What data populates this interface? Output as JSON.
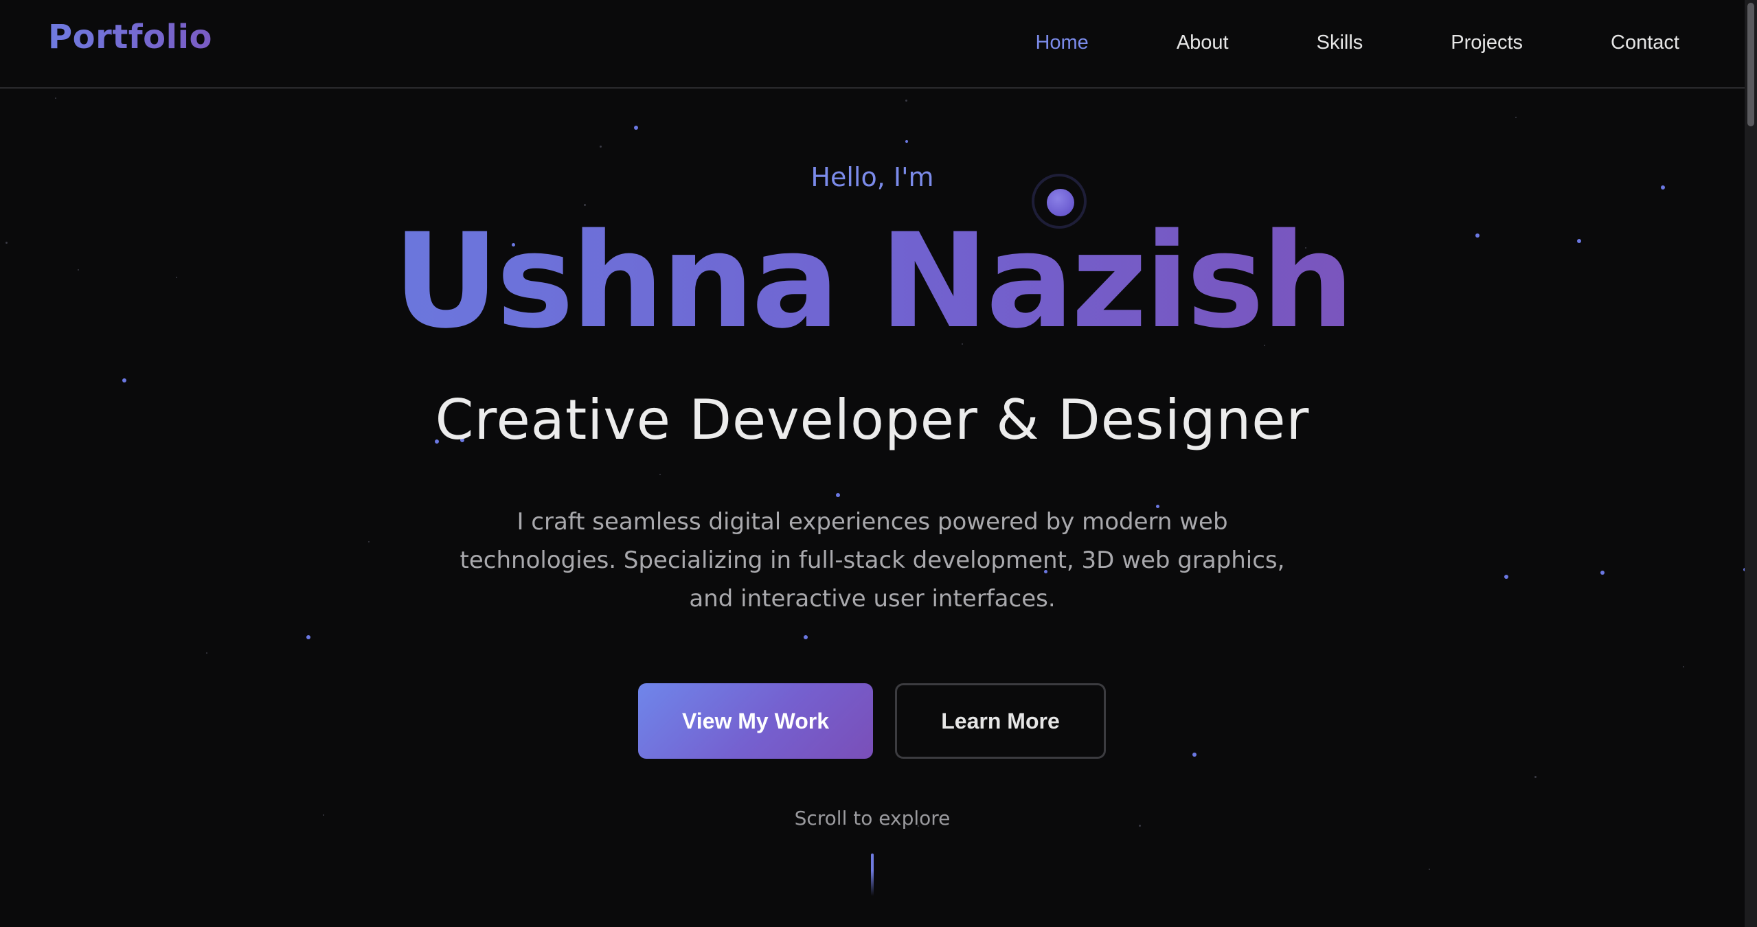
{
  "header": {
    "logo": "Portfolio",
    "nav": [
      {
        "label": "Home",
        "active": true
      },
      {
        "label": "About",
        "active": false
      },
      {
        "label": "Skills",
        "active": false
      },
      {
        "label": "Projects",
        "active": false
      },
      {
        "label": "Contact",
        "active": false
      }
    ]
  },
  "hero": {
    "greeting": "Hello, I'm",
    "name": "Ushna Nazish",
    "role": "Creative Developer & Designer",
    "description": "I craft seamless digital experiences powered by modern web technologies. Specializing in full-stack development, 3D web graphics, and interactive user interfaces.",
    "primary_button": "View My Work",
    "secondary_button": "Learn More",
    "scroll_hint": "Scroll to explore"
  },
  "colors": {
    "background": "#0a0a0b",
    "accent": "#7b8bea",
    "accent_purple": "#7a55bd",
    "text": "#ececec",
    "muted": "#a9a9ad"
  },
  "icons": {
    "orb": "glowing-orb-icon",
    "scroll": "scroll-indicator-icon"
  }
}
